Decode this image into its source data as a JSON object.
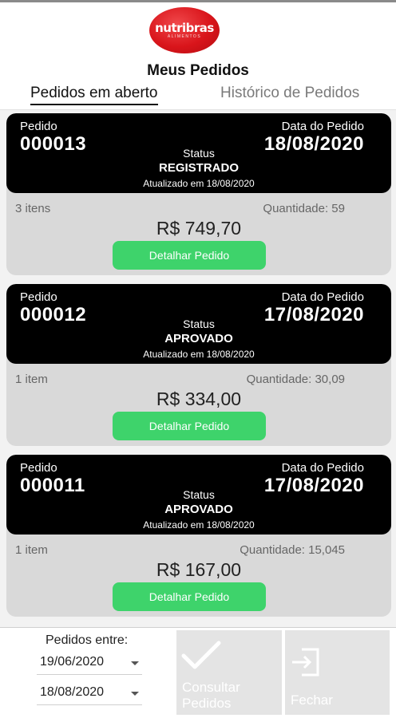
{
  "brand": {
    "logo_text": "nutribras",
    "logo_sub": "ALIMENTOS"
  },
  "page": {
    "title": "Meus Pedidos"
  },
  "tabs": [
    {
      "label": "Pedidos em aberto",
      "active": true
    },
    {
      "label": "Histórico de Pedidos",
      "active": false
    }
  ],
  "labels": {
    "pedido": "Pedido",
    "data_pedido": "Data do Pedido",
    "status": "Status",
    "detail_button": "Detalhar Pedido"
  },
  "orders": [
    {
      "number": "000013",
      "date": "18/08/2020",
      "status": "REGISTRADO",
      "updated": "Atualizado em 18/08/2020",
      "items": "3 itens",
      "quantity": "Quantidade: 59",
      "total": "R$ 749,70"
    },
    {
      "number": "000012",
      "date": "17/08/2020",
      "status": "APROVADO",
      "updated": "Atualizado em 18/08/2020",
      "items": "1 item",
      "quantity": "Quantidade: 30,09",
      "total": "R$ 334,00"
    },
    {
      "number": "000011",
      "date": "17/08/2020",
      "status": "APROVADO",
      "updated": "Atualizado em 18/08/2020",
      "items": "1 item",
      "quantity": "Quantidade: 15,045",
      "total": "R$ 167,00"
    }
  ],
  "filter": {
    "label": "Pedidos entre:",
    "start_date": "19/06/2020",
    "end_date": "18/08/2020"
  },
  "actions": {
    "consult_line1": "Consultar",
    "consult_line2": "Pedidos",
    "consult_icon": "checkmark-icon",
    "close_label": "Fechar",
    "close_icon": "exit-icon"
  },
  "colors": {
    "brand_red": "#d9151b",
    "detail_button": "#3ed36b",
    "card_header": "#000000",
    "card_body": "#d9d9d9",
    "action_disabled": "#e4e4e4"
  }
}
